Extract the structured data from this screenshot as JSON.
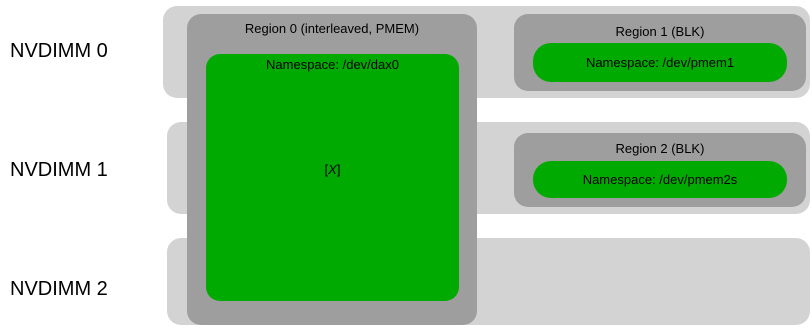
{
  "dimms": [
    {
      "label": "NVDIMM 0"
    },
    {
      "label": "NVDIMM 1"
    },
    {
      "label": "NVDIMM 2"
    }
  ],
  "regions": [
    {
      "title": "Region 0 (interleaved, PMEM)",
      "namespace": "Namespace: /dev/dax0",
      "content_prefix": "[",
      "content_var": "X",
      "content_suffix": "]"
    },
    {
      "title": "Region 1 (BLK)",
      "namespace": "Namespace: /dev/pmem1"
    },
    {
      "title": "Region 2 (BLK)",
      "namespace": "Namespace: /dev/pmem2s"
    }
  ],
  "colors": {
    "dimm_background": "#d3d3d3",
    "region_background": "#9e9e9e",
    "namespace_fill": "#00aa00"
  }
}
